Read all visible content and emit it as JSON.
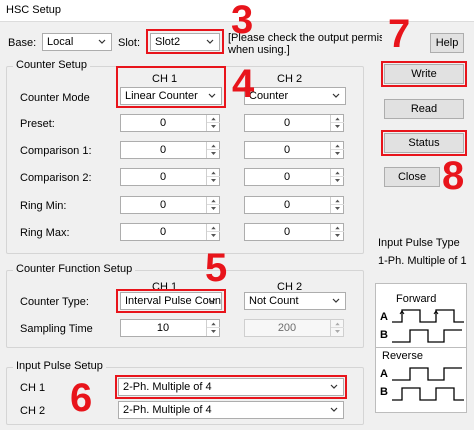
{
  "window": {
    "title": "HSC Setup"
  },
  "header": {
    "base_label": "Base:",
    "base_value": "Local",
    "slot_label": "Slot:",
    "slot_value": "Slot2",
    "note": "[Please check the output permission",
    "note_line2": "when using.]",
    "help_label": "Help"
  },
  "counter_setup": {
    "title": "Counter Setup",
    "ch1_header": "CH 1",
    "ch2_header": "CH 2",
    "rows": [
      {
        "label": "Counter Mode",
        "ch1": "Linear Counter",
        "ch2": "Counter"
      },
      {
        "label": "Preset:",
        "ch1": "0",
        "ch2": "0"
      },
      {
        "label": "Comparison 1:",
        "ch1": "0",
        "ch2": "0"
      },
      {
        "label": "Comparison 2:",
        "ch1": "0",
        "ch2": "0"
      },
      {
        "label": "Ring Min:",
        "ch1": "0",
        "ch2": "0"
      },
      {
        "label": "Ring Max:",
        "ch1": "0",
        "ch2": "0"
      }
    ]
  },
  "buttons": {
    "write": "Write",
    "read": "Read",
    "status": "Status",
    "close": "Close"
  },
  "function_setup": {
    "title": "Counter Function Setup",
    "ch1_header": "CH 1",
    "ch2_header": "CH 2",
    "counter_type_label": "Counter Type:",
    "counter_type_ch1": "Interval Pulse Count",
    "counter_type_ch2": "Not Count",
    "sampling_label": "Sampling Time",
    "sampling_ch1": "10",
    "sampling_ch2": "200"
  },
  "pulse_setup": {
    "title": "Input Pulse Setup",
    "ch1_label": "CH 1",
    "ch1_value": "2-Ph. Multiple of 4",
    "ch2_label": "CH 2",
    "ch2_value": "2-Ph. Multiple of 4"
  },
  "pulse_info": {
    "title": "Input Pulse Type",
    "value": "1-Ph. Multiple of 1",
    "forward": "Forward",
    "reverse": "Reverse",
    "a": "A",
    "b": "B"
  },
  "annotations": [
    "3",
    "4",
    "5",
    "6",
    "7",
    "8"
  ],
  "colors": {
    "highlight": "#e8141b",
    "window_bg": "#f0f0f0"
  }
}
